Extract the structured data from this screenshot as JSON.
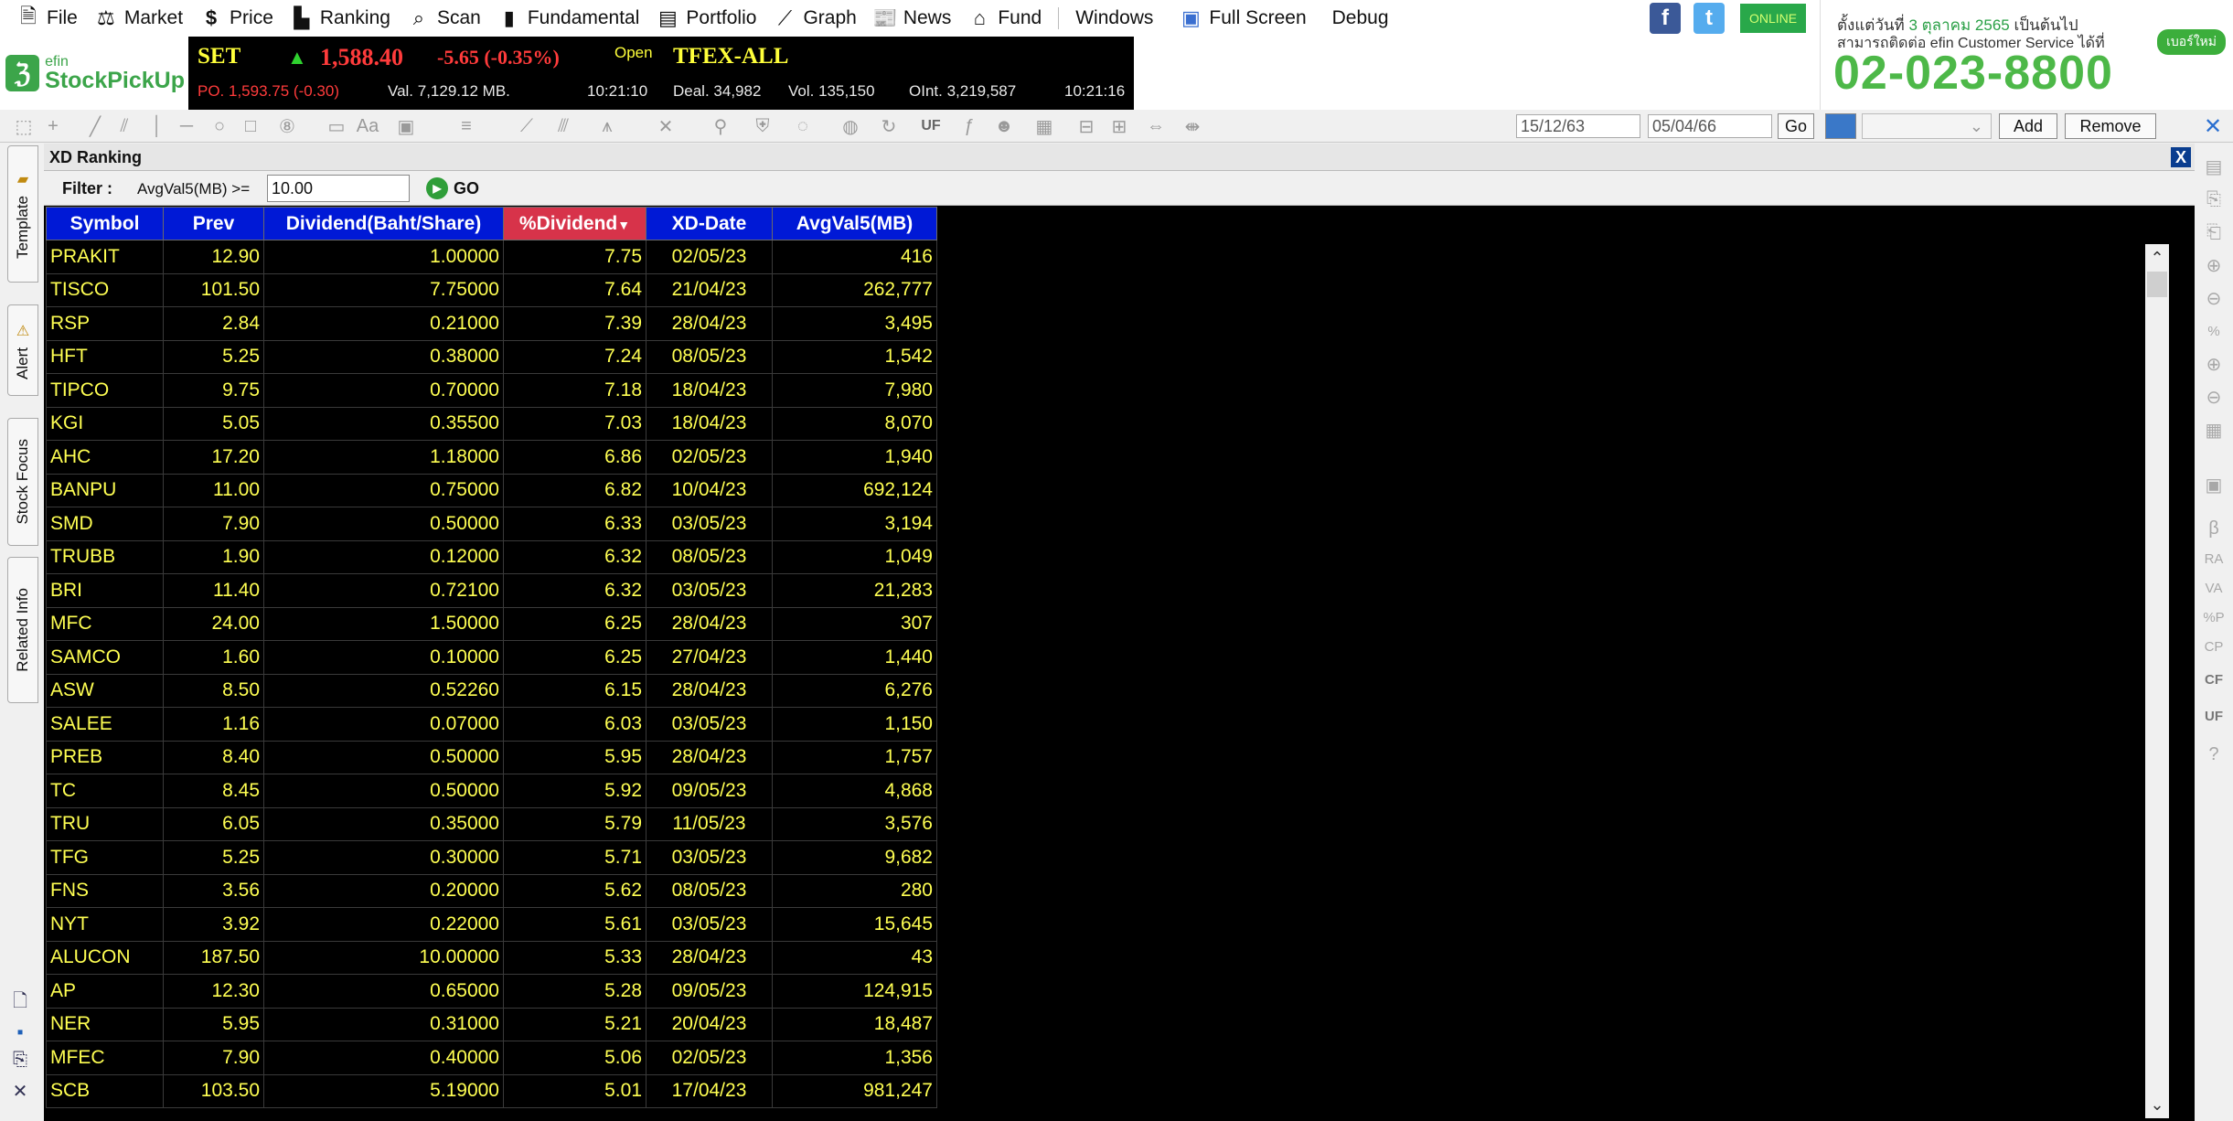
{
  "menu": [
    {
      "label": "File",
      "icon": "file-icon"
    },
    {
      "label": "Market",
      "icon": "market-icon"
    },
    {
      "label": "Price",
      "icon": "dollar-icon"
    },
    {
      "label": "Ranking",
      "icon": "ranking-icon"
    },
    {
      "label": "Scan",
      "icon": "scan-icon"
    },
    {
      "label": "Fundamental",
      "icon": "fundamental-icon"
    },
    {
      "label": "Portfolio",
      "icon": "portfolio-icon"
    },
    {
      "label": "Graph",
      "icon": "graph-icon"
    },
    {
      "label": "News",
      "icon": "news-icon"
    },
    {
      "label": "Fund",
      "icon": "fund-icon"
    }
  ],
  "menu_plain": [
    "Windows",
    "Full Screen",
    "Debug"
  ],
  "status_badge": "ONLINE",
  "ad": {
    "line1_prefix": "ตั้งแต่วันที่",
    "line1_date": "3 ตุลาคม 2565",
    "line1_suffix": "เป็นต้นไป",
    "line2": "สามารถติดต่อ efin Customer Service ได้ที่",
    "badge": "เบอร์ใหม่",
    "phone": "02-023-8800"
  },
  "logo": {
    "line1": "efin",
    "line2": "StockPickUp"
  },
  "ticker": {
    "set_label": "SET",
    "set_value": "1,588.40",
    "set_change": "-5.65 (-0.35%)",
    "set_status": "Open",
    "set_po": "PO. 1,593.75 (-0.30)",
    "set_val": "Val. 7,129.12 MB.",
    "set_time": "10:21:10",
    "tfex_label": "TFEX-ALL",
    "tfex_deal": "Deal. 34,982",
    "tfex_vol": "Vol. 135,150",
    "tfex_oint": "OInt. 3,219,587",
    "tfex_time": "10:21:16"
  },
  "toolbar": {
    "date_from": "15/12/63",
    "date_to": "05/04/66",
    "go": "Go",
    "add": "Add",
    "remove": "Remove",
    "uf_label": "UF"
  },
  "left_tabs": [
    "Template",
    "Alert",
    "Stock Focus",
    "Related Info"
  ],
  "panel": {
    "title": "XD Ranking",
    "close": "X",
    "filter_label": "Filter :",
    "filter_condition": "AvgVal5(MB) >=",
    "filter_value": "10.00",
    "go": "GO"
  },
  "table": {
    "columns": [
      "Symbol",
      "Prev",
      "Dividend(Baht/Share)",
      "%Dividend",
      "XD-Date",
      "AvgVal5(MB)"
    ],
    "sorted_column": "%Dividend",
    "rows": [
      [
        "PRAKIT",
        "12.90",
        "1.00000",
        "7.75",
        "02/05/23",
        "416"
      ],
      [
        "TISCO",
        "101.50",
        "7.75000",
        "7.64",
        "21/04/23",
        "262,777"
      ],
      [
        "RSP",
        "2.84",
        "0.21000",
        "7.39",
        "28/04/23",
        "3,495"
      ],
      [
        "HFT",
        "5.25",
        "0.38000",
        "7.24",
        "08/05/23",
        "1,542"
      ],
      [
        "TIPCO",
        "9.75",
        "0.70000",
        "7.18",
        "18/04/23",
        "7,980"
      ],
      [
        "KGI",
        "5.05",
        "0.35500",
        "7.03",
        "18/04/23",
        "8,070"
      ],
      [
        "AHC",
        "17.20",
        "1.18000",
        "6.86",
        "02/05/23",
        "1,940"
      ],
      [
        "BANPU",
        "11.00",
        "0.75000",
        "6.82",
        "10/04/23",
        "692,124"
      ],
      [
        "SMD",
        "7.90",
        "0.50000",
        "6.33",
        "03/05/23",
        "3,194"
      ],
      [
        "TRUBB",
        "1.90",
        "0.12000",
        "6.32",
        "08/05/23",
        "1,049"
      ],
      [
        "BRI",
        "11.40",
        "0.72100",
        "6.32",
        "03/05/23",
        "21,283"
      ],
      [
        "MFC",
        "24.00",
        "1.50000",
        "6.25",
        "28/04/23",
        "307"
      ],
      [
        "SAMCO",
        "1.60",
        "0.10000",
        "6.25",
        "27/04/23",
        "1,440"
      ],
      [
        "ASW",
        "8.50",
        "0.52260",
        "6.15",
        "28/04/23",
        "6,276"
      ],
      [
        "SALEE",
        "1.16",
        "0.07000",
        "6.03",
        "03/05/23",
        "1,150"
      ],
      [
        "PREB",
        "8.40",
        "0.50000",
        "5.95",
        "28/04/23",
        "1,757"
      ],
      [
        "TC",
        "8.45",
        "0.50000",
        "5.92",
        "09/05/23",
        "4,868"
      ],
      [
        "TRU",
        "6.05",
        "0.35000",
        "5.79",
        "11/05/23",
        "3,576"
      ],
      [
        "TFG",
        "5.25",
        "0.30000",
        "5.71",
        "03/05/23",
        "9,682"
      ],
      [
        "FNS",
        "3.56",
        "0.20000",
        "5.62",
        "08/05/23",
        "280"
      ],
      [
        "NYT",
        "3.92",
        "0.22000",
        "5.61",
        "03/05/23",
        "15,645"
      ],
      [
        "ALUCON",
        "187.50",
        "10.00000",
        "5.33",
        "28/04/23",
        "43"
      ],
      [
        "AP",
        "12.30",
        "0.65000",
        "5.28",
        "09/05/23",
        "124,915"
      ],
      [
        "NER",
        "5.95",
        "0.31000",
        "5.21",
        "20/04/23",
        "18,487"
      ],
      [
        "MFEC",
        "7.90",
        "0.40000",
        "5.06",
        "02/05/23",
        "1,356"
      ],
      [
        "SCB",
        "103.50",
        "5.19000",
        "5.01",
        "17/04/23",
        "981,247"
      ]
    ]
  },
  "right_tools": [
    "RA",
    "VA",
    "%P",
    "CP",
    "CF",
    "UF"
  ],
  "colors": {
    "header_bg": "#0019d6",
    "sorted_header_bg": "#d7334a",
    "cell_text": "#ffff52",
    "up_arrow": "#2fd12f",
    "down_value": "#ff3b3b",
    "brand_green": "#4db848"
  }
}
